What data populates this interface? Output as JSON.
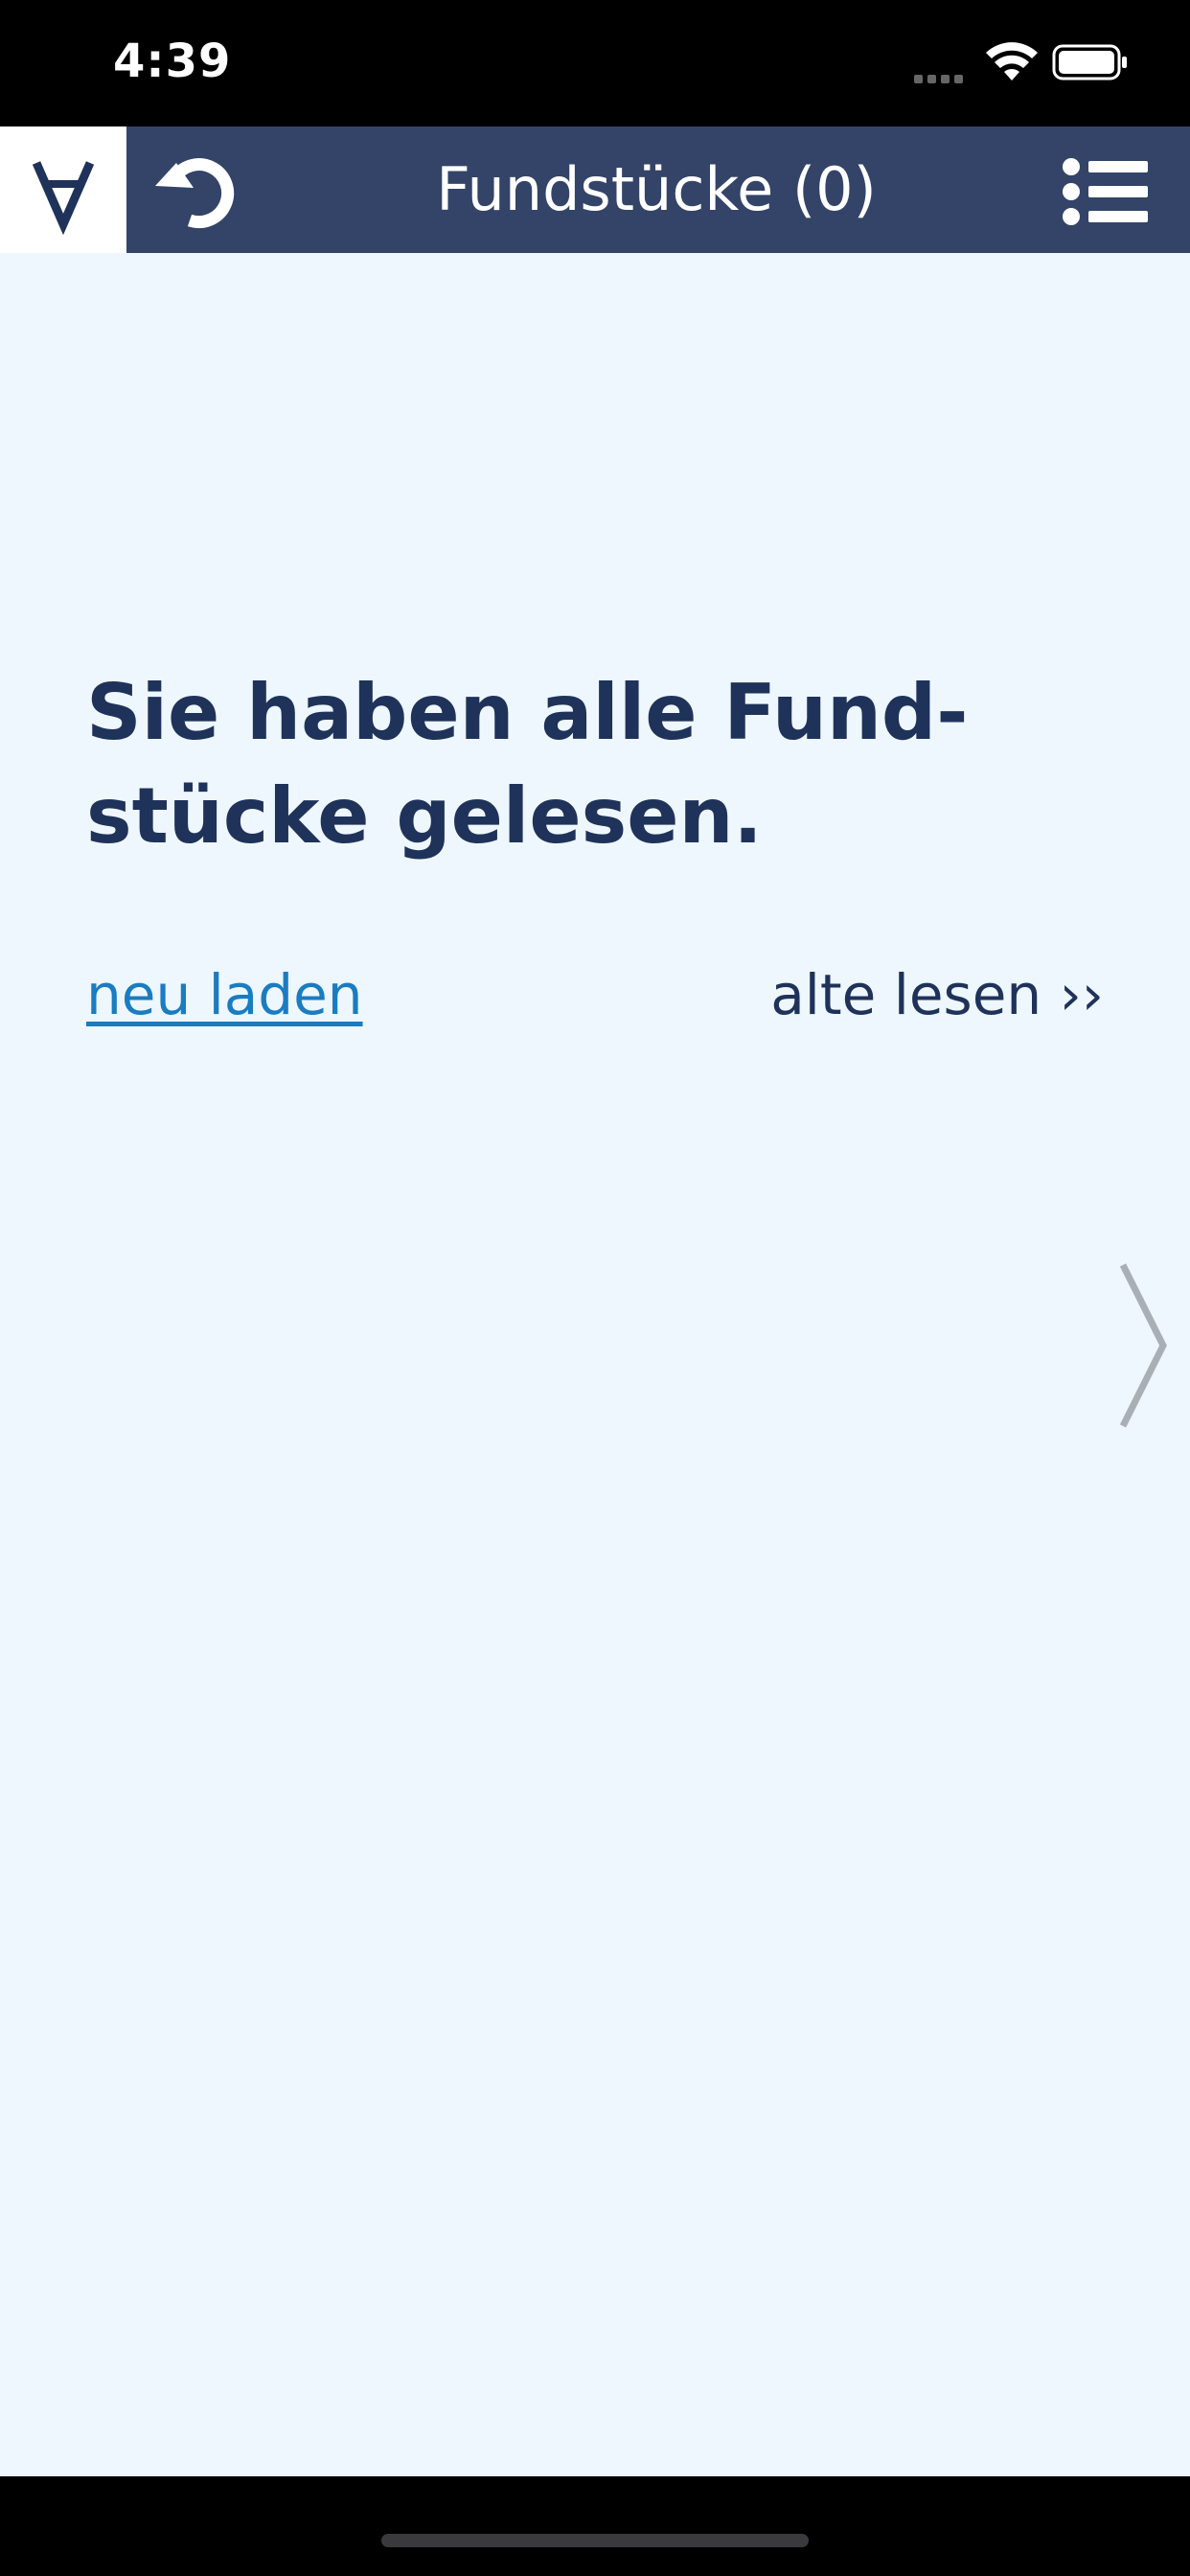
{
  "status_bar": {
    "time": "4:39"
  },
  "header": {
    "title": "Fundstücke (0)",
    "icons": {
      "logo": "turned-a-logo",
      "refresh": "refresh-icon",
      "menu": "list-menu-icon"
    }
  },
  "main": {
    "heading": "Sie haben alle Fund-\nstücke gelesen.",
    "reload_label": "neu laden",
    "old_label": "alte lesen ››",
    "next_icon": "chevron-right-icon"
  },
  "colors": {
    "header_bg": "#334468",
    "content_bg": "#eef7fd",
    "heading_text": "#1f325a",
    "link": "#1a7cc1",
    "chevron": "#a9b0b5"
  }
}
